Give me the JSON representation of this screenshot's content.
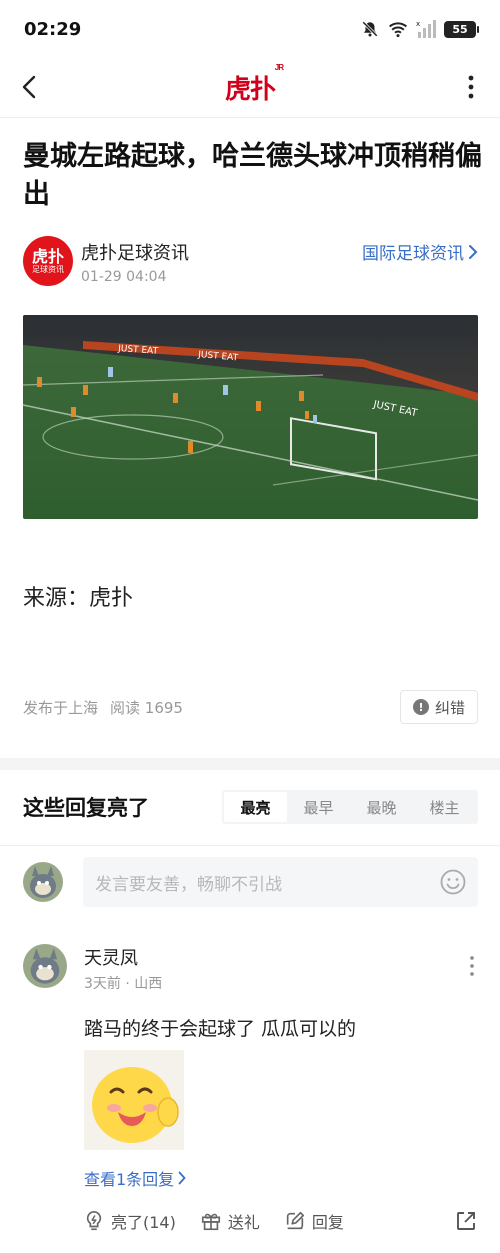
{
  "status_bar": {
    "time": "02:29",
    "battery": "55"
  },
  "nav": {
    "logo": "虎扑",
    "logo_badge": "JR"
  },
  "article": {
    "title": "曼城左路起球，哈兰德头球冲顶稍稍偏出",
    "author": {
      "name": "虎扑足球资讯",
      "avatar_line1": "虎扑",
      "avatar_line2": "足球资讯",
      "time": "01-29 04:04"
    },
    "category": "国际足球资讯",
    "source": "来源：虎扑",
    "location": "发布于上海",
    "reads": "阅读 1695",
    "correction_label": "纠错"
  },
  "comments_section": {
    "title": "这些回复亮了",
    "sort_tabs": [
      {
        "label": "最亮",
        "active": true
      },
      {
        "label": "最早",
        "active": false
      },
      {
        "label": "最晚",
        "active": false
      },
      {
        "label": "楼主",
        "active": false
      }
    ],
    "input_placeholder": "发言要友善，畅聊不引战"
  },
  "comments": [
    {
      "user": "天灵凤",
      "time": "3天前 · 山西",
      "text": "踏马的终于会起球了 瓜瓜可以的",
      "view_replies": "查看1条回复",
      "actions": {
        "like": "亮了(14)",
        "gift": "送礼",
        "reply": "回复"
      }
    }
  ],
  "colors": {
    "brand_red": "#d0021b",
    "link_blue": "#3a6ec6"
  },
  "icons": [
    "back-icon",
    "more-vertical-icon",
    "chevron-right-icon",
    "alert-icon",
    "emoji-icon",
    "bulb-icon",
    "gift-icon",
    "edit-icon",
    "share-icon"
  ]
}
